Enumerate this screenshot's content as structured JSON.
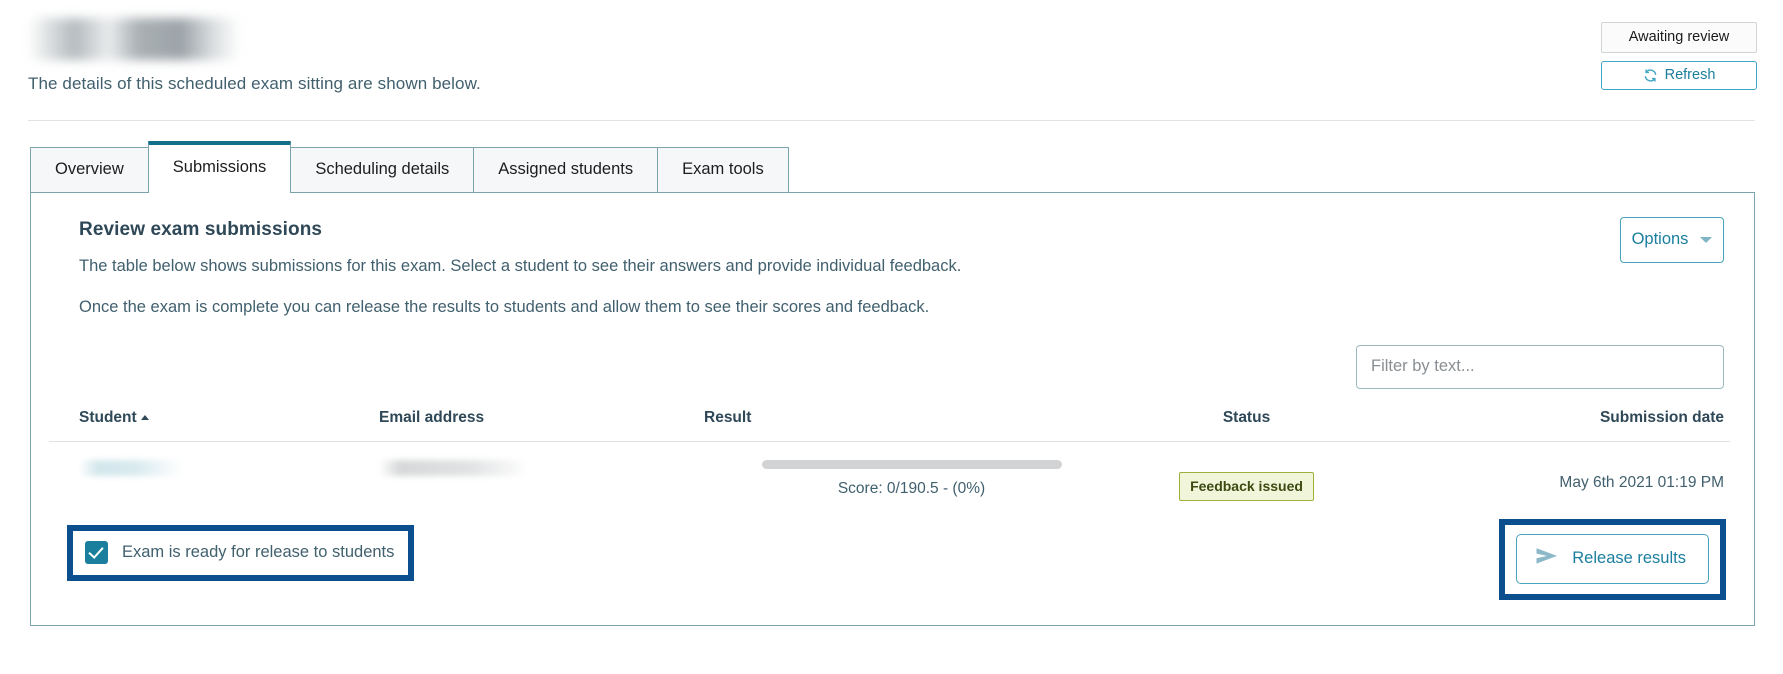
{
  "header": {
    "title_redacted": "",
    "subtitle": "The details of this scheduled exam sitting are shown below.",
    "status_label": "Awaiting review",
    "refresh_label": "Refresh",
    "refresh_icon": "refresh-icon"
  },
  "tabs": [
    {
      "label": "Overview",
      "active": false
    },
    {
      "label": "Submissions",
      "active": true
    },
    {
      "label": "Scheduling details",
      "active": false
    },
    {
      "label": "Assigned students",
      "active": false
    },
    {
      "label": "Exam tools",
      "active": false
    }
  ],
  "panel": {
    "title": "Review exam submissions",
    "para1": "The table below shows submissions for this exam. Select a student to see their answers and provide individual feedback.",
    "para2": "Once the exam is complete you can release the results to students and allow them to see their scores and feedback.",
    "options_label": "Options",
    "options_caret_icon": "chevron-down-icon"
  },
  "filter": {
    "placeholder": "Filter by text...",
    "value": ""
  },
  "table": {
    "columns": [
      {
        "key": "student",
        "label": "Student",
        "sorted": "asc"
      },
      {
        "key": "email",
        "label": "Email address",
        "sorted": ""
      },
      {
        "key": "result",
        "label": "Result",
        "sorted": ""
      },
      {
        "key": "status",
        "label": "Status",
        "sorted": ""
      },
      {
        "key": "date",
        "label": "Submission date",
        "sorted": ""
      }
    ],
    "rows": [
      {
        "student": "",
        "email": "",
        "score_text": "Score: 0/190.5 - (0%)",
        "score_value": 0,
        "score_max": 190.5,
        "score_percent": 0,
        "status": "Feedback issued",
        "date": "May 6th 2021 01:19 PM"
      }
    ]
  },
  "footer": {
    "ready_checkbox_label": "Exam is ready for release to students",
    "ready_checkbox_checked": true,
    "release_label": "Release results",
    "release_icon": "send-icon"
  },
  "colors": {
    "accent_teal": "#1b7e9e",
    "tab_active_border": "#136f89",
    "panel_border": "#7ba3ab",
    "badge_green_border": "#9ab23a",
    "badge_green_bg": "#f1f5da",
    "annotation_navy": "#0b4f8f",
    "text_body": "#41606e"
  }
}
